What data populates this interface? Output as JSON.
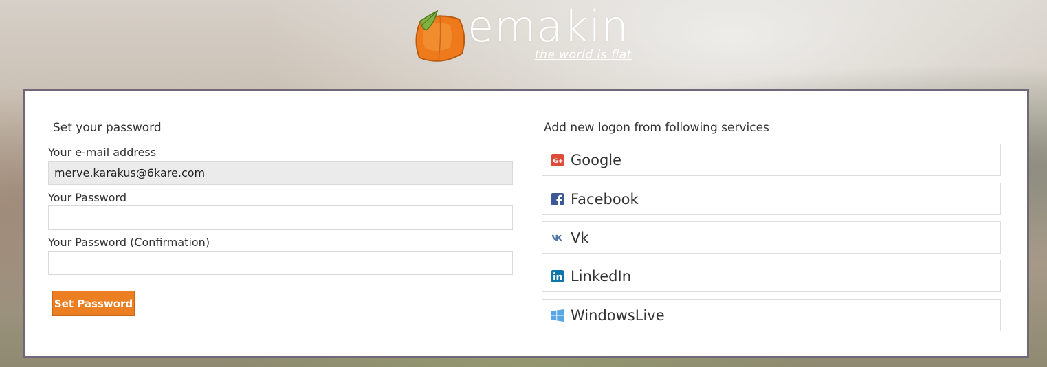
{
  "logo": {
    "wordmark": "emakin",
    "tagline": "the world is flat"
  },
  "password_form": {
    "title": "Set your password",
    "email_label": "Your e-mail address",
    "email_value": "merve.karakus@6kare.com",
    "password_label": "Your Password",
    "password_value": "",
    "confirm_label": "Your Password (Confirmation)",
    "confirm_value": "",
    "submit_label": "Set Password"
  },
  "logon_services": {
    "title": "Add new logon from following services",
    "items": [
      {
        "label": "Google",
        "icon": "google-plus-icon",
        "color": "#dd4b39"
      },
      {
        "label": "Facebook",
        "icon": "facebook-icon",
        "color": "#3b5998"
      },
      {
        "label": "Vk",
        "icon": "vk-icon",
        "color": "#4c75a3"
      },
      {
        "label": "LinkedIn",
        "icon": "linkedin-icon",
        "color": "#0e76a8"
      },
      {
        "label": "WindowsLive",
        "icon": "windows-icon",
        "color": "#5aa7e6"
      }
    ]
  },
  "colors": {
    "accent": "#ec7f22",
    "card_border": "#6f6878"
  }
}
